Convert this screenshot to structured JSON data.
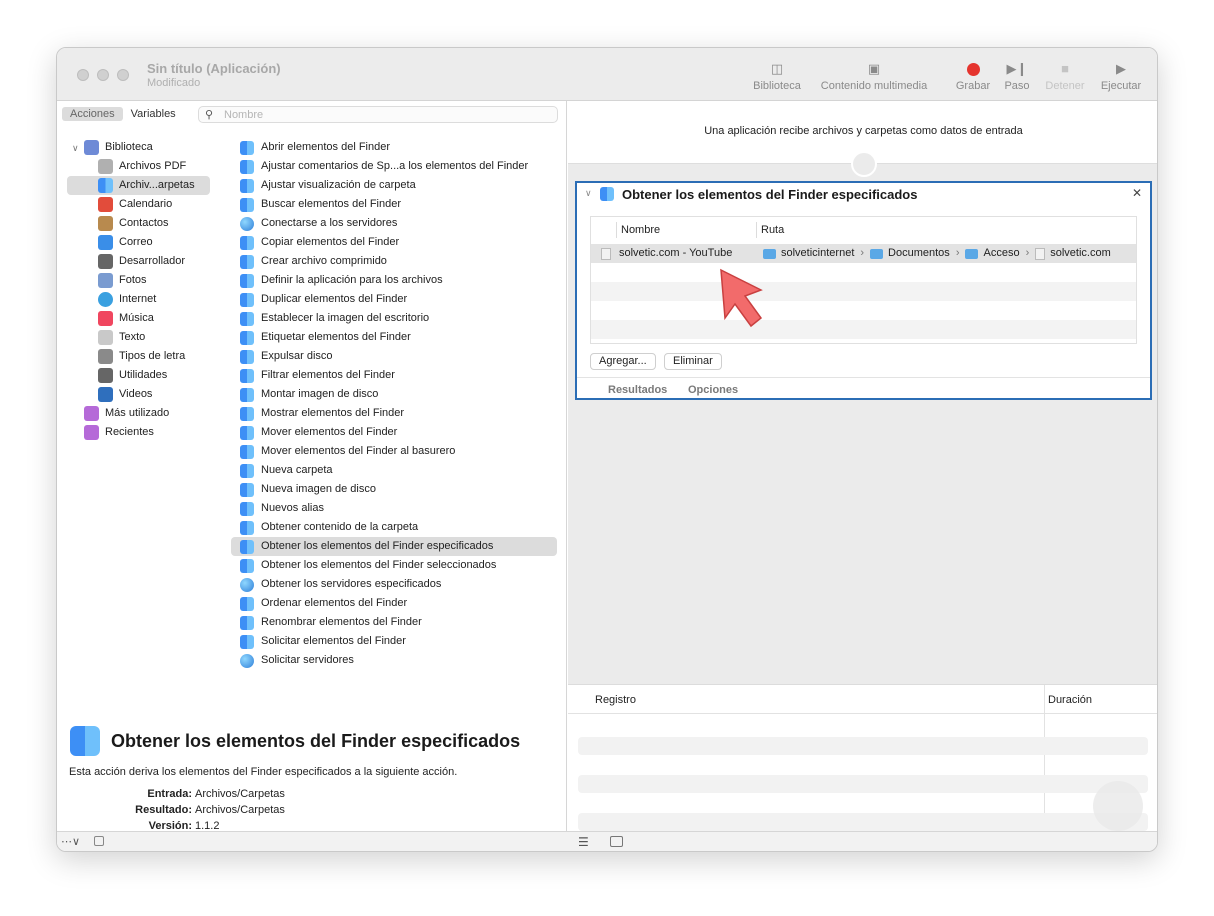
{
  "window": {
    "title": "Sin título (Aplicación)",
    "subtitle": "Modificado"
  },
  "toolbar": {
    "biblioteca": "Biblioteca",
    "contenido": "Contenido multimedia",
    "grabar": "Grabar",
    "paso": "Paso",
    "detener": "Detener",
    "ejecutar": "Ejecutar",
    "record_color": "#e5342e"
  },
  "left": {
    "tab_acciones": "Acciones",
    "tab_variables": "Variables",
    "search_placeholder": "Nombre",
    "library": [
      {
        "label": "Biblioteca",
        "icon": "library-icon",
        "color": "#6e8ad6"
      },
      {
        "label": "Archivos PDF",
        "icon": "pdf-icon",
        "color": "#b0b0b0"
      },
      {
        "label": "Archiv...arpetas",
        "icon": "finder-icon",
        "color": "#3d8ff5"
      },
      {
        "label": "Calendario",
        "icon": "calendar-icon",
        "color": "#e24c3b"
      },
      {
        "label": "Contactos",
        "icon": "contacts-icon",
        "color": "#b88a4e"
      },
      {
        "label": "Correo",
        "icon": "mail-icon",
        "color": "#3a8ee8"
      },
      {
        "label": "Desarrollador",
        "icon": "tools-icon",
        "color": "#666666"
      },
      {
        "label": "Fotos",
        "icon": "photos-icon",
        "color": "#7a9bd0"
      },
      {
        "label": "Internet",
        "icon": "globe-icon",
        "color": "#3aa0e0"
      },
      {
        "label": "Música",
        "icon": "music-icon",
        "color": "#f0465f"
      },
      {
        "label": "Texto",
        "icon": "text-icon",
        "color": "#c9c9c9"
      },
      {
        "label": "Tipos de letra",
        "icon": "fonts-icon",
        "color": "#8a8a8a"
      },
      {
        "label": "Utilidades",
        "icon": "utilities-icon",
        "color": "#666666"
      },
      {
        "label": "Videos",
        "icon": "video-icon",
        "color": "#2f6fbd"
      },
      {
        "label": "Más utilizado",
        "icon": "smart-folder-icon",
        "color": "#b56ad8"
      },
      {
        "label": "Recientes",
        "icon": "smart-folder-icon",
        "color": "#b56ad8"
      }
    ],
    "actions": [
      "Abrir elementos del Finder",
      "Ajustar comentarios de Sp...a los elementos del Finder",
      "Ajustar visualización de carpeta",
      "Buscar elementos del Finder",
      "Conectarse a los servidores",
      "Copiar elementos del Finder",
      "Crear archivo comprimido",
      "Definir la aplicación para los archivos",
      "Duplicar elementos del Finder",
      "Establecer la imagen del escritorio",
      "Etiquetar elementos del Finder",
      "Expulsar disco",
      "Filtrar elementos del Finder",
      "Montar imagen de disco",
      "Mostrar elementos del Finder",
      "Mover elementos del Finder",
      "Mover elementos del Finder al basurero",
      "Nueva carpeta",
      "Nueva imagen de disco",
      "Nuevos alias",
      "Obtener contenido de la carpeta",
      "Obtener los elementos del Finder especificados",
      "Obtener los elementos del Finder seleccionados",
      "Obtener los servidores especificados",
      "Ordenar elementos del Finder",
      "Renombrar elementos del Finder",
      "Solicitar elementos del Finder",
      "Solicitar servidores"
    ],
    "description": {
      "title": "Obtener los elementos del Finder especificados",
      "text": "Esta acción deriva los elementos del Finder especificados a la siguiente acción.",
      "entrada_label": "Entrada:",
      "entrada": "Archivos/Carpetas",
      "resultado_label": "Resultado:",
      "resultado": "Archivos/Carpetas",
      "version_label": "Versión:",
      "version": "1.1.2"
    }
  },
  "right": {
    "message": "Una aplicación recibe archivos y carpetas como datos de entrada",
    "card": {
      "title": "Obtener los elementos del Finder especificados",
      "col_nombre": "Nombre",
      "col_ruta": "Ruta",
      "row_name": "solvetic.com - YouTube",
      "path": [
        "solveticinternet",
        "Documentos",
        "Acceso",
        "solvetic.com"
      ],
      "add_button": "Agregar...",
      "remove_button": "Eliminar",
      "tab_resultados": "Resultados",
      "tab_opciones": "Opciones"
    },
    "log": {
      "col_registro": "Registro",
      "col_duracion": "Duración"
    }
  }
}
